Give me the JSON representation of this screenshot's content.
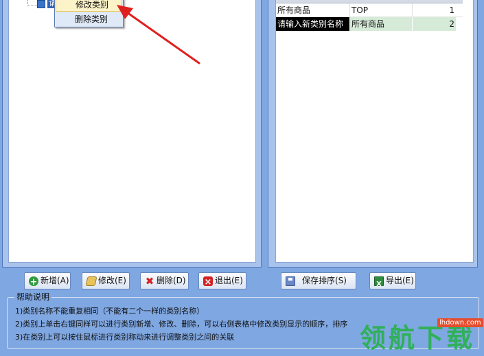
{
  "tree": {
    "node_label": "请"
  },
  "context_menu": {
    "items": [
      {
        "label": "修改类别"
      },
      {
        "label": "删除类别"
      }
    ]
  },
  "grid": {
    "rows": [
      {
        "name": "所有商品",
        "parent": "TOP",
        "order": "1"
      },
      {
        "name": "请输入新类别名称",
        "parent": "所有商品",
        "order": "2"
      }
    ]
  },
  "toolbar": {
    "add_label": "新增(A)",
    "edit_label": "修改(E)",
    "delete_label": "删除(D)",
    "exit_label": "退出(E)",
    "save_order_label": "保存排序(S)",
    "export_label": "导出(E)"
  },
  "help": {
    "title": "帮助说明",
    "lines": [
      "1)类别名称不能重复相同（不能有二个一样的类别名称）",
      "2)类别上单击右键同样可以进行类别新增、修改、删除，可以右侧表格中修改类别显示的顺序，排序",
      "3)在类别上可以按住鼠标进行类别称动来进行调整类别之间的关联"
    ]
  },
  "watermark": {
    "site": "lhdown.com",
    "logo": "领航下载"
  },
  "colors": {
    "background": "#7fa7e2",
    "arrow": "#e0201f",
    "selected_cell": "#000000",
    "row_highlight": "#d6ead8"
  },
  "icons": [
    "add-icon",
    "edit-icon",
    "delete-icon",
    "exit-icon",
    "save-icon",
    "excel-icon"
  ]
}
